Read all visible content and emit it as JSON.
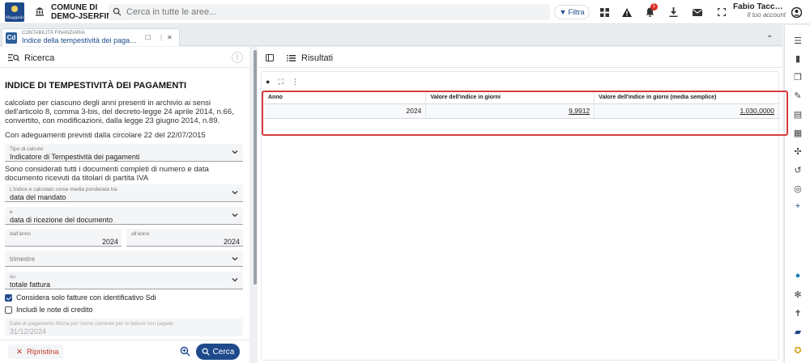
{
  "topbar": {
    "logo_text": "Maggioli",
    "org_line1": "COMUNE DI",
    "org_line2": "DEMO-JSERFIN",
    "search_placeholder": "Cerca in tutte le aree...",
    "filter_label": "Filtra",
    "notification_count": "1",
    "user_name": "Fabio Tacconelli",
    "user_sub": "Il tuo account"
  },
  "tab": {
    "icon_text": "Cd",
    "category": "CONTABILITÀ FINANZIARIA",
    "title": "Indice della tempestività dei pagamenti"
  },
  "search_panel": {
    "title": "Ricerca",
    "heading": "INDICE DI TEMPESTIVITÀ DEI PAGAMENTI",
    "intro": "calcolato per ciascuno degli anni presenti in archivio ai sensi dell'articolo 8, comma 3-bis, del decreto-legge 24 aprile 2014, n.66, convertito, con modificazioni, dalla legge 23 giugno 2014, n.89.",
    "note": "Con adeguamenti previsti dalla circolare 22 del 22/07/2015",
    "tipo_calcolo": {
      "label": "Tipo di calcolo",
      "value": "Indicatore di Tempestività dei pagamenti"
    },
    "docs_note": "Sono considerati tutti i documenti completi di numero e data documento ricevuti da titolari di partita IVA",
    "media_tra": {
      "label": "L'indice è calcolato come media ponderata tra",
      "value": "data del mandato"
    },
    "e_field": {
      "label": "e",
      "value": "data di ricezione del documento"
    },
    "dall_anno": {
      "label": "dall'anno",
      "value": "2024"
    },
    "all_anno": {
      "label": "all'anno",
      "value": "2024"
    },
    "trimestre": {
      "label": "trimestre",
      "value": ""
    },
    "su": {
      "label": "su",
      "value": "totale fattura"
    },
    "check_sdi": "Considera solo fatture con identificativo Sdi",
    "check_note": "Includi le note di credito",
    "data_fittizia": {
      "label": "Data di pagamento fittizia per l'anno corrente per le fatture non pagate",
      "value": "31/12/2024"
    },
    "reset_label": "Ripristina",
    "search_label": "Cerca"
  },
  "results_panel": {
    "title": "Risultati",
    "columns": [
      "Anno",
      "Valore dell'indice in giorni",
      "Valore dell'indice in giorni (media semplice)"
    ],
    "rows": [
      {
        "anno": "2024",
        "indice": "9,9912",
        "media": "1.030,0000"
      }
    ]
  },
  "colors": {
    "primary": "#1e4a8c",
    "highlight": "#d93b3b",
    "danger": "#c0392b"
  }
}
